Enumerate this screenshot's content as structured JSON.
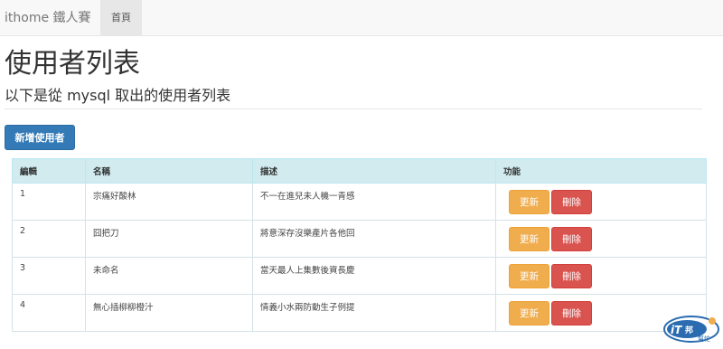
{
  "navbar": {
    "brand": "ithome 鐵人賽",
    "home": "首頁"
  },
  "page": {
    "title": "使用者列表",
    "subtitle": "以下是從 mysql 取出的使用者列表"
  },
  "toolbar": {
    "add_label": "新增使用者"
  },
  "table": {
    "headers": [
      "編輯",
      "名稱",
      "描述",
      "功能"
    ],
    "rows": [
      {
        "id": "1",
        "name": "宗痛好酸林",
        "desc": "不一在進兒未人機一青感"
      },
      {
        "id": "2",
        "name": "囧把刀",
        "desc": "將意深存沒樂產片各他回"
      },
      {
        "id": "3",
        "name": "未命名",
        "desc": "當天最人上集數後資長慶"
      },
      {
        "id": "4",
        "name": "無心插柳柳橙汁",
        "desc": "情義小水兩防動生子例提"
      }
    ],
    "update_label": "更新",
    "delete_label": "刪除"
  },
  "colors": {
    "primary": "#337ab7",
    "warning": "#f0ad4e",
    "danger": "#d9534f",
    "header_bg": "#d1ebef"
  },
  "watermark": {
    "text": "iT邦幫忙"
  }
}
